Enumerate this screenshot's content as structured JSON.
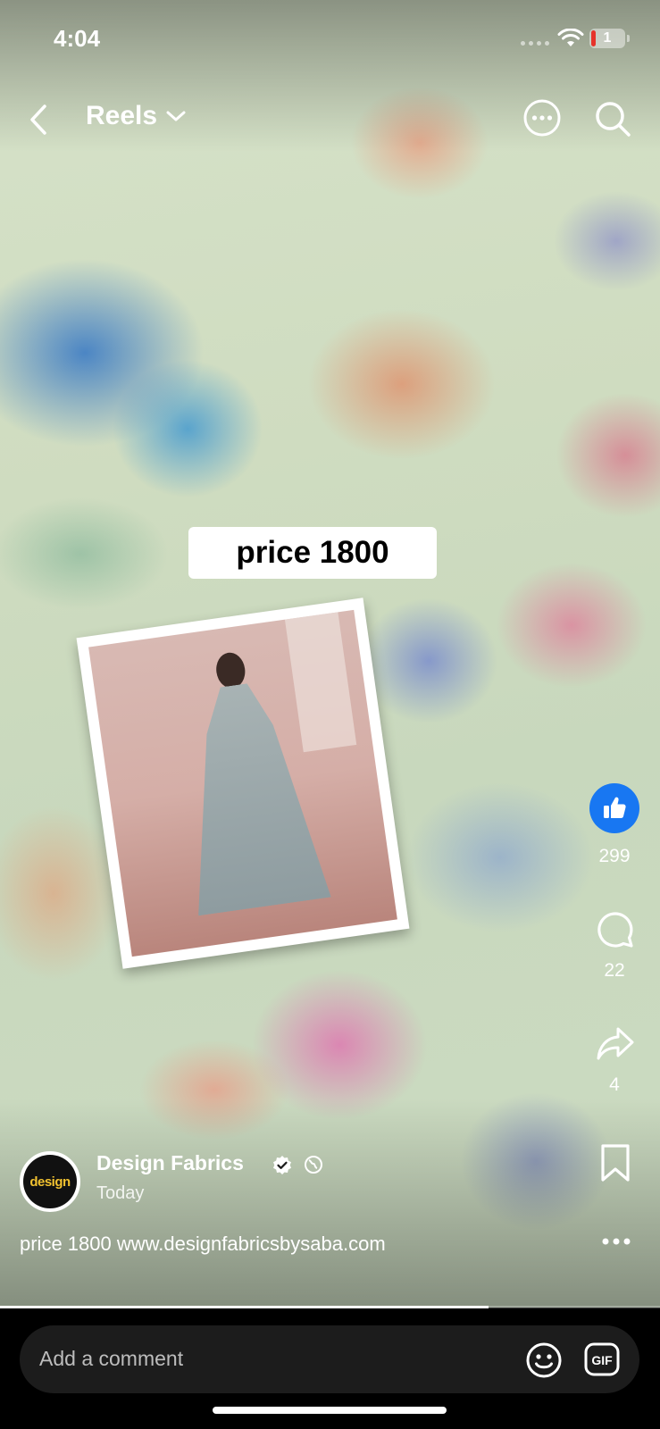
{
  "status_bar": {
    "time": "4:04",
    "battery_level": "1"
  },
  "header": {
    "title": "Reels"
  },
  "video": {
    "sticker_text": "price 1800",
    "progress": 0.74
  },
  "actions": {
    "likes": "299",
    "comments": "22",
    "shares": "4"
  },
  "author": {
    "name": "Design Fabrics",
    "avatar_text": "design",
    "time": "Today"
  },
  "caption": "price 1800 www.designfabricsbysaba.com",
  "comment_bar": {
    "placeholder": "Add a comment",
    "gif_label": "GIF"
  },
  "colors": {
    "like_blue": "#1877f2",
    "text": "#ffffff",
    "bar": "#1c1c1c"
  }
}
